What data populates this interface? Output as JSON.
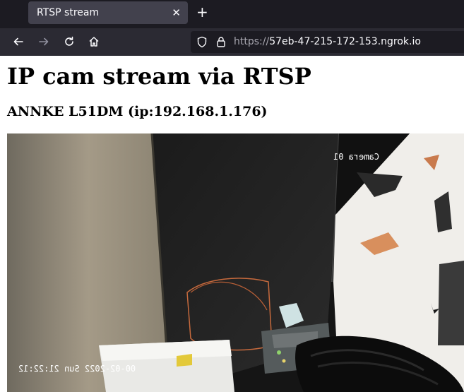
{
  "browser": {
    "tab_title": "RTSP stream",
    "tab_close": "✕",
    "new_tab": "+",
    "url_scheme": "https://",
    "url_host": "57eb-47-215-172-153.ngrok.io"
  },
  "page": {
    "title": "IP cam stream via RTSP",
    "subtitle": "ANNKE L51DM (ip:192.168.1.176)"
  },
  "video": {
    "camera_label": "Camera 01",
    "timestamp": "00-02-2022 Sun 21:22:12"
  },
  "icons": {
    "back": "back-arrow-icon",
    "forward": "forward-arrow-icon",
    "reload": "reload-icon",
    "home": "home-icon",
    "tracking": "shield-icon",
    "lock": "lock-icon"
  },
  "colors": {
    "chrome_dark": "#1c1b22",
    "nav_bar": "#2b2a33",
    "tab_active": "#42414d"
  }
}
